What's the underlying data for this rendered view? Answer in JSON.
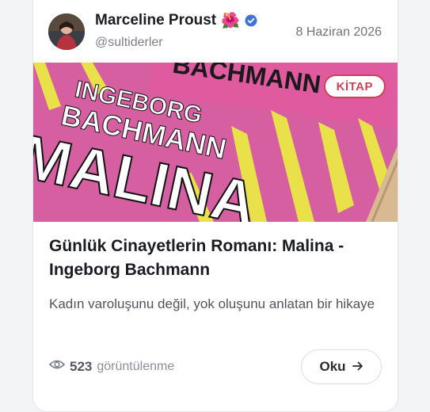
{
  "author": {
    "name": "Marceline Proust",
    "emoji": "🌺",
    "handle": "@sultiderler"
  },
  "post": {
    "date": "8 Haziran 2026",
    "category_badge": "KİTAP",
    "cover": {
      "book_author_line1": "INGEBORG",
      "book_author_line2": "BACHMANN",
      "book_title": "MALINA",
      "back_text": "BACHMANN"
    },
    "title": "Günlük Cinayetlerin Romanı: Malina - Ingeborg Bachmann",
    "excerpt": "Kadın varoluşunu değil, yok oluşunu anlatan bir hikaye",
    "views": "523",
    "views_label": "görüntülenme",
    "read_label": "Oku"
  },
  "colors": {
    "badge": "#cc4257",
    "verified": "#3f74d6",
    "cover_pink": "#d55fa1",
    "cover_yellow": "#e9e14a"
  },
  "icons": {
    "verified": "verified-check-icon",
    "views": "eye-icon",
    "read": "arrow-right-icon"
  }
}
